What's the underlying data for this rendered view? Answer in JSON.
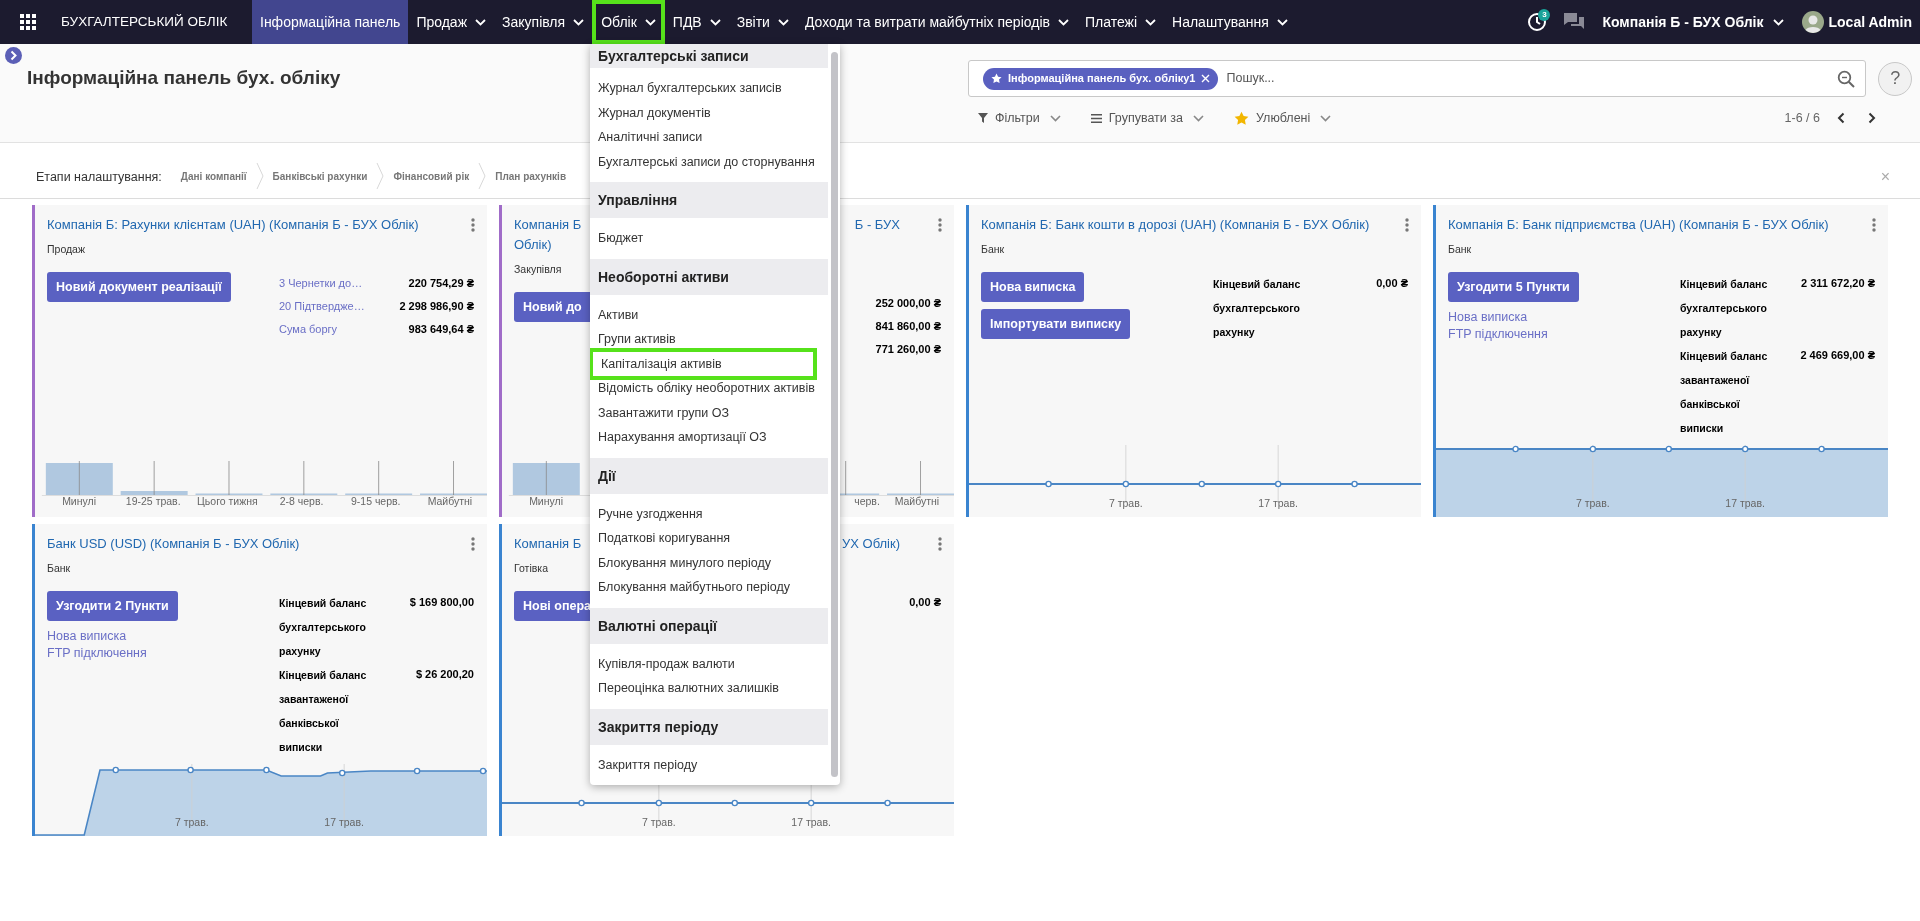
{
  "app": {
    "title": "БУХГАЛТЕРСЬКИЙ ОБЛІК"
  },
  "nav": [
    {
      "label": "Інформаційна панель",
      "selected": true,
      "has_menu": false,
      "highlighted": false
    },
    {
      "label": "Продаж",
      "selected": false,
      "has_menu": true,
      "highlighted": false
    },
    {
      "label": "Закупівля",
      "selected": false,
      "has_menu": true,
      "highlighted": false
    },
    {
      "label": "Облік",
      "selected": false,
      "has_menu": true,
      "highlighted": true
    },
    {
      "label": "ПДВ",
      "selected": false,
      "has_menu": true,
      "highlighted": false
    },
    {
      "label": "Звіти",
      "selected": false,
      "has_menu": true,
      "highlighted": false
    },
    {
      "label": "Доходи та витрати майбутніх періодів",
      "selected": false,
      "has_menu": true,
      "highlighted": false
    },
    {
      "label": "Платежі",
      "selected": false,
      "has_menu": true,
      "highlighted": false
    },
    {
      "label": "Налаштування",
      "selected": false,
      "has_menu": true,
      "highlighted": false
    }
  ],
  "systray": {
    "activity_count": "3",
    "company": "Компанія Б - БУХ Облік",
    "user": "Local Admin"
  },
  "page": {
    "title": "Інформаційна панель бух. обліку"
  },
  "search": {
    "facet": "Інформаційна панель бух. обліку1",
    "placeholder": "Пошук...",
    "help": "?"
  },
  "filters": [
    {
      "kind": "filter",
      "label": "Фільтри"
    },
    {
      "kind": "group",
      "label": "Групувати за"
    },
    {
      "kind": "favorite",
      "label": "Улюблені"
    }
  ],
  "pager": "1-6 / 6",
  "setup": {
    "label": "Етапи налаштування:",
    "steps": [
      "Дані компанії",
      "Банківські рахунки",
      "Фінансовий рік",
      "План рахунків"
    ],
    "close": "×"
  },
  "cards": [
    {
      "kind": "full",
      "color": "#a06cc8",
      "title_lines": [
        [
          "Компанія Б: Рахунки клієнтам (UAH) (Компанія Б - БУХ Облік)"
        ]
      ],
      "subtitle": "Продаж",
      "buttons": [
        "Новий документ реалізації"
      ],
      "stats": [
        {
          "kind": "link",
          "label": "3 Чернетки до…",
          "value": "220 754,29 ₴"
        },
        {
          "kind": "link",
          "label": "20 Підтвердже…",
          "value": "2 298 986,90 ₴"
        },
        {
          "kind": "link",
          "label": "Сума боргу",
          "value": "983 649,64 ₴"
        }
      ],
      "chart": {
        "kind": "bar",
        "labels_left": [
          "Минулі",
          "19-25 трав.",
          "Цього тижня",
          "2-8 черв.",
          "9-15 черв.",
          "Майбутні"
        ]
      }
    },
    {
      "kind": "partial",
      "color": "#a06cc8",
      "title_lines": [
        [
          "Компанія Б",
          "Б - БУХ"
        ],
        [
          "Облік)"
        ]
      ],
      "subtitle": "Закупівля",
      "buttons": [
        "Новий до"
      ],
      "stats": [
        {
          "kind": "value",
          "value": "252 000,00 ₴"
        },
        {
          "kind": "value",
          "value": "841 860,00 ₴"
        },
        {
          "kind": "value",
          "value": "771 260,00 ₴"
        }
      ],
      "chart": {
        "kind": "bar",
        "labels_left": [
          "Минулі"
        ],
        "labels_right": [
          "черв.",
          "Майбутні"
        ]
      }
    },
    {
      "kind": "full",
      "color": "#3a84d0",
      "title_lines": [
        [
          "Компанія Б: Банк кошти в дорозі (UAH) (Компанія Б - БУХ Облік)"
        ]
      ],
      "subtitle": "Банк",
      "buttons": [
        "Нова виписка",
        "Імпортувати виписку"
      ],
      "stats": [
        {
          "kind": "balance",
          "label": "Кінцевий баланс бухгалтерського рахунку",
          "value": "0,00 ₴"
        }
      ],
      "chart": {
        "kind": "line",
        "labels": [
          "7 трав.",
          "17 трав."
        ]
      }
    },
    {
      "kind": "full",
      "color": "#3a84d0",
      "title_lines": [
        [
          "Компанія Б: Банк підприємства (UAH) (Компанія Б - БУХ Облік)"
        ]
      ],
      "subtitle": "Банк",
      "buttons": [
        "Узгодити 5 Пункти"
      ],
      "links": [
        "Нова виписка",
        "FTP підключення"
      ],
      "stats": [
        {
          "kind": "balance",
          "label": "Кінцевий баланс бухгалтерського рахунку",
          "value": "2 311 672,20 ₴"
        },
        {
          "kind": "balance",
          "label": "Кінцевий баланс завантаженої банківської виписки",
          "value": "2 469 669,00 ₴"
        }
      ],
      "chart": {
        "kind": "area",
        "labels": [
          "7 трав.",
          "17 трав."
        ]
      }
    },
    {
      "kind": "full",
      "color": "#3a84d0",
      "title_lines": [
        [
          "Банк USD (USD) (Компанія Б - БУХ Облік)"
        ]
      ],
      "subtitle": "Банк",
      "buttons": [
        "Узгодити 2 Пункти"
      ],
      "links": [
        "Нова виписка",
        "FTP підключення"
      ],
      "stats": [
        {
          "kind": "balance",
          "label": "Кінцевий баланс бухгалтерського рахунку",
          "value": "$ 169 800,00"
        },
        {
          "kind": "balance",
          "label": "Кінцевий баланс завантаженої банківської виписки",
          "value": "$ 26 200,20"
        }
      ],
      "chart": {
        "kind": "step_area",
        "labels": [
          "7 трав.",
          "17 трав."
        ]
      }
    },
    {
      "kind": "partial",
      "color": "#3a84d0",
      "title_lines": [
        [
          "Компанія Б",
          "УХ Облік)"
        ]
      ],
      "subtitle": "Готівка",
      "buttons": [
        "Нові опера"
      ],
      "stats": [
        {
          "kind": "value",
          "value": "0,00 ₴"
        }
      ],
      "chart": {
        "kind": "line",
        "labels": [
          "7 трав.",
          "17 трав."
        ]
      }
    }
  ],
  "menu": {
    "sections": [
      {
        "title": "Бухгалтерські записи",
        "items": [
          {
            "label": "Журнал бухгалтерських записів",
            "highlighted": false
          },
          {
            "label": "Журнал документів",
            "highlighted": false
          },
          {
            "label": "Аналітичні записи",
            "highlighted": false
          },
          {
            "label": "Бухгалтерські записи до сторнування",
            "highlighted": false
          }
        ]
      },
      {
        "title": "Управління",
        "items": [
          {
            "label": "Бюджет",
            "highlighted": false
          }
        ]
      },
      {
        "title": "Необоротні активи",
        "items": [
          {
            "label": "Активи",
            "highlighted": false
          },
          {
            "label": "Групи активів",
            "highlighted": false
          },
          {
            "label": "Капіталізація активів",
            "highlighted": true
          },
          {
            "label": "Відомість обліку необоротних активів",
            "highlighted": false
          },
          {
            "label": "Завантажити групи ОЗ",
            "highlighted": false
          },
          {
            "label": "Нарахування амортизації ОЗ",
            "highlighted": false
          }
        ]
      },
      {
        "title": "Дії",
        "items": [
          {
            "label": "Ручне узгодження",
            "highlighted": false
          },
          {
            "label": "Податкові коригування",
            "highlighted": false
          },
          {
            "label": "Блокування минулого періоду",
            "highlighted": false
          },
          {
            "label": "Блокування майбутнього періоду",
            "highlighted": false
          }
        ]
      },
      {
        "title": "Валютні операції",
        "items": [
          {
            "label": "Купівля-продаж валюти",
            "highlighted": false
          },
          {
            "label": "Переоцінка валютних залишків",
            "highlighted": false
          }
        ]
      },
      {
        "title": "Закриття періоду",
        "items": [
          {
            "label": "Закриття періоду",
            "highlighted": false
          }
        ]
      }
    ]
  }
}
